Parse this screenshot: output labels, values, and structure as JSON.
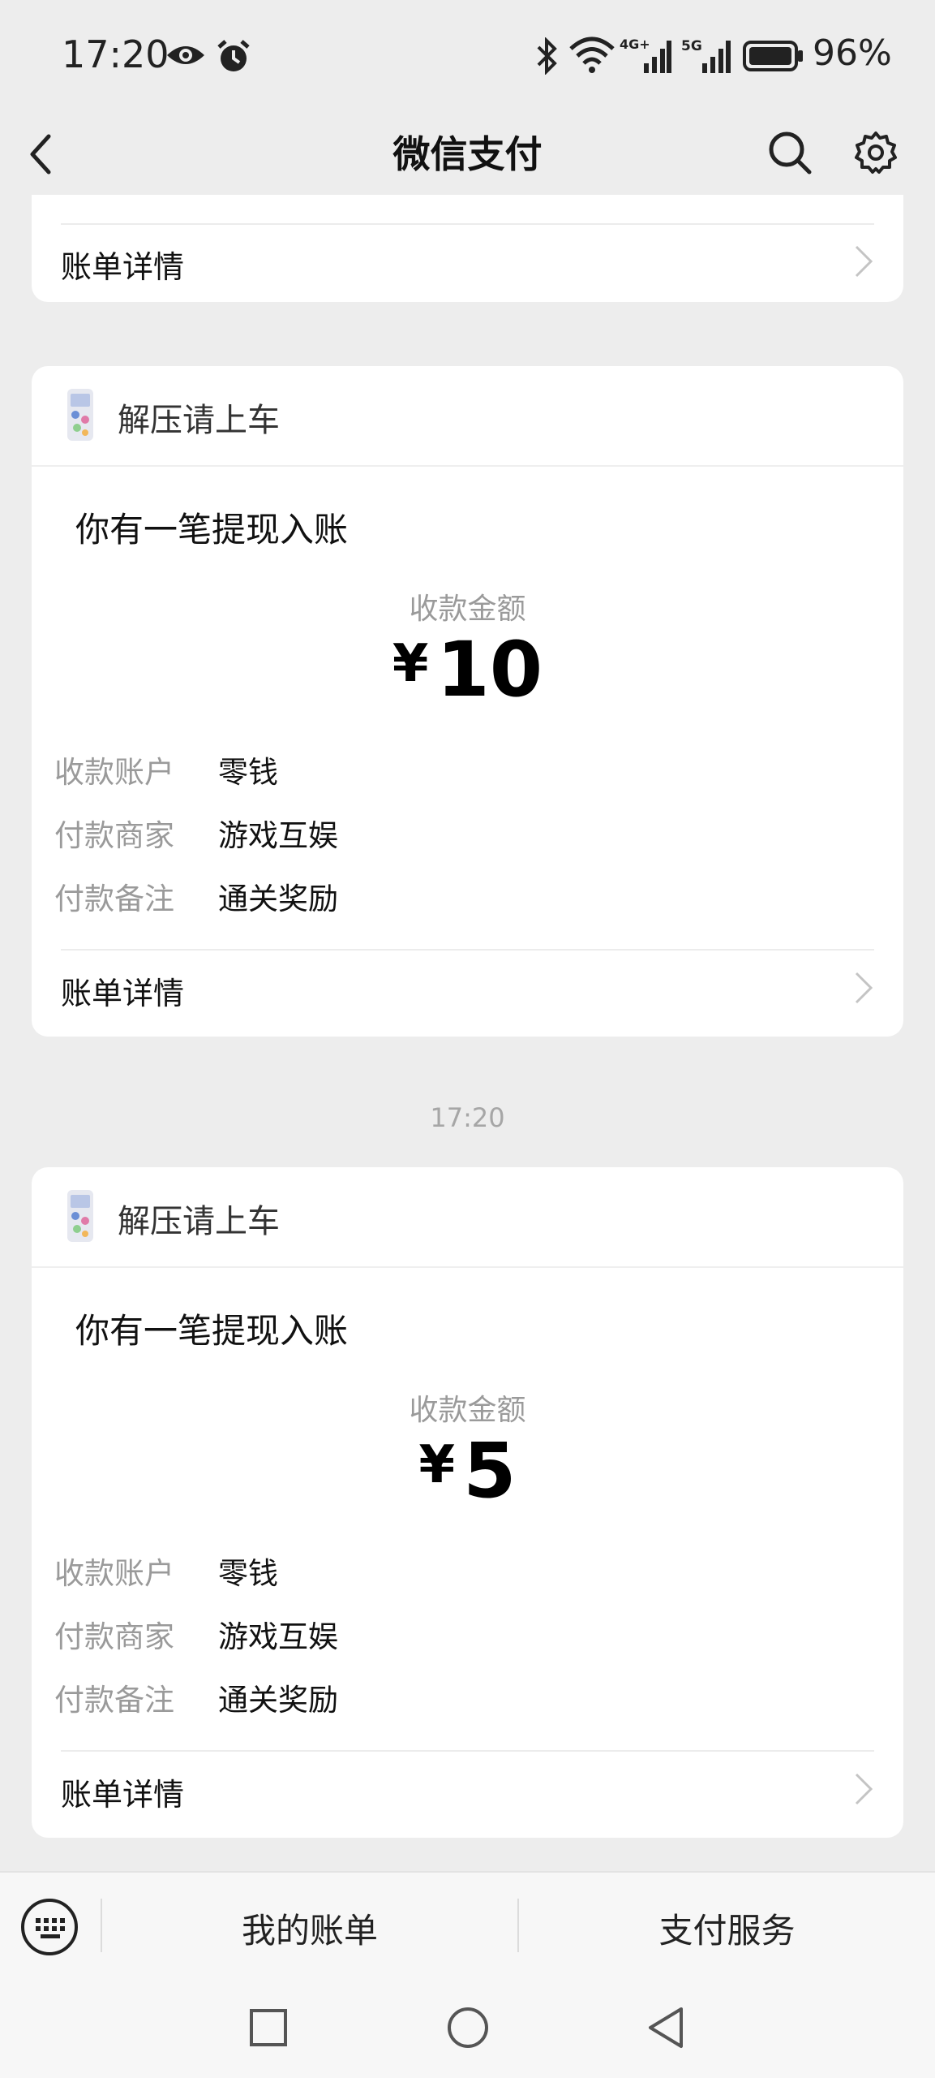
{
  "status_bar": {
    "time": "17:20",
    "battery": "96%",
    "icons": [
      "eye-icon",
      "alarm-icon",
      "bluetooth-icon",
      "wifi-icon",
      "4g-signal-icon",
      "5g-signal-icon",
      "battery-icon"
    ]
  },
  "nav": {
    "title": "微信支付",
    "back_icon": "back-arrow-icon",
    "search_icon": "search-icon",
    "settings_icon": "settings-gear-icon"
  },
  "top_partial_card": {
    "link_label": "账单详情"
  },
  "cards": [
    {
      "merchant": "解压请上车",
      "title": "你有一笔提现入账",
      "amount_label": "收款金额",
      "currency": "¥",
      "amount": "10",
      "rows": [
        {
          "key": "收款账户",
          "value": "零钱"
        },
        {
          "key": "付款商家",
          "value": "游戏互娱"
        },
        {
          "key": "付款备注",
          "value": "通关奖励"
        }
      ],
      "link_label": "账单详情"
    },
    {
      "merchant": "解压请上车",
      "title": "你有一笔提现入账",
      "amount_label": "收款金额",
      "currency": "¥",
      "amount": "5",
      "rows": [
        {
          "key": "收款账户",
          "value": "零钱"
        },
        {
          "key": "付款商家",
          "value": "游戏互娱"
        },
        {
          "key": "付款备注",
          "value": "通关奖励"
        }
      ],
      "link_label": "账单详情"
    }
  ],
  "timestamp": "17:20",
  "bottom_bar": {
    "keyboard_icon": "keyboard-icon",
    "my_bills": "我的账单",
    "pay_services": "支付服务"
  },
  "system_nav": [
    "recents-square-icon",
    "home-circle-icon",
    "back-triangle-icon"
  ],
  "colors": {
    "background": "#ededed",
    "card": "#ffffff",
    "secondary_text": "#9a9a9a"
  }
}
